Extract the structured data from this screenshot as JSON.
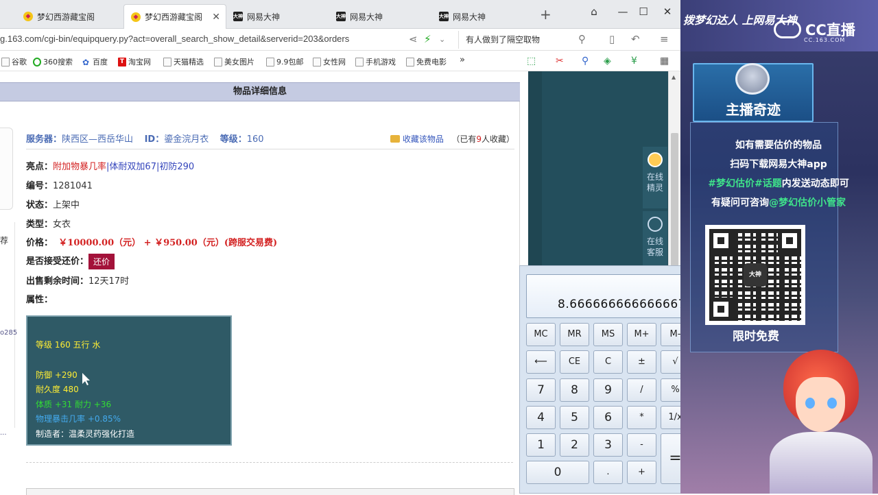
{
  "browser": {
    "tabs": [
      {
        "title": "梦幻西游藏宝阁",
        "icon": "duck-icon",
        "active": false
      },
      {
        "title": "梦幻西游藏宝阁",
        "icon": "duck-icon",
        "active": true
      },
      {
        "title": "网易大神",
        "icon": "dashen-icon",
        "active": false
      },
      {
        "title": "网易大神",
        "icon": "dashen-icon",
        "active": false
      },
      {
        "title": "网易大神",
        "icon": "dashen-icon",
        "active": false
      }
    ],
    "tab_icon_label": "大神",
    "new_tab": "+",
    "url": "g.163.com/cgi-bin/equipquery.py?act=overall_search_show_detail&serverid=203&orders",
    "search_text": "有人做到了隔空取物",
    "bookmarks": [
      "谷歌",
      "360搜索",
      "百度",
      "淘宝网",
      "天猫精选",
      "美女图片",
      "9.9包邮",
      "女性网",
      "手机游戏",
      "免费电影"
    ],
    "bookmark_more": "»",
    "taobao_mark": "T"
  },
  "panel": {
    "title": "物品详细信息",
    "server_label": "服务器：",
    "server_value": "陕西区—西岳华山",
    "id_label": "ID：",
    "id_value": "鎏金浣月衣",
    "level_label": "等级：",
    "level_value": "160",
    "favorite_link": "收藏该物品",
    "favorite_count_pre": "（已有",
    "favorite_count": "9",
    "favorite_count_post": "人收藏）",
    "highlight_label": "亮点：",
    "highlight_1": "附加物暴几率",
    "highlight_sep": "|",
    "highlight_2": "体耐双加67",
    "highlight_3": "初防290",
    "serial_label": "编号：",
    "serial_value": "1281041",
    "status_label": "状态：",
    "status_value": "上架中",
    "type_label": "类型：",
    "type_value": "女衣",
    "price_label": "价格：",
    "price_value": "￥10000.00（元） + ￥950.00（元）(跨服交易费)",
    "counter_label": "是否接受还价：",
    "counter_button": "还价",
    "remain_label": "出售剩余时间：",
    "remain_value": "12天17时",
    "attr_label": "属性："
  },
  "attributes": {
    "level_line": "等级 160  五行 水",
    "defense": "防御 +290",
    "durability": "耐久度 480",
    "bonus": "体质 +31  耐力 +36",
    "crit": "物理暴击几率 +0.85%",
    "maker": "制造者：温柔灵药强化打造"
  },
  "left_strip": {
    "item_a": "荐",
    "item_b": "o285",
    "item_c": "..."
  },
  "side_buttons": {
    "elf_line1": "在线",
    "elf_line2": "精灵",
    "cs_line1": "在线",
    "cs_line2": "客服"
  },
  "calculator": {
    "display": "8.666666666666667",
    "keys": {
      "mc": "MC",
      "mr": "MR",
      "ms": "MS",
      "mplus": "M+",
      "mminus": "M-",
      "back": "⟵",
      "ce": "CE",
      "c": "C",
      "plusminus": "±",
      "sqrt": "√",
      "k7": "7",
      "k8": "8",
      "k9": "9",
      "div": "/",
      "pct": "%",
      "k4": "4",
      "k5": "5",
      "k6": "6",
      "mul": "*",
      "recip": "1/x",
      "k1": "1",
      "k2": "2",
      "k3": "3",
      "sub": "-",
      "eq": "=",
      "k0": "0",
      "dot": ".",
      "add": "+"
    }
  },
  "cc_stream": {
    "slogan": "拨梦幻达人 上网易大神",
    "logo": "CC直播",
    "logo_sub": "CC.163.COM",
    "anchor_name": "主播奇迹",
    "line1": "如有需要估价的物品",
    "line2": "扫码下载网易大神app",
    "line3_tag": "#梦幻估价#话题",
    "line3_rest": "内发送动态即可",
    "line4_pre": "有疑问可咨询",
    "line4_handle": "@梦幻估价小管家",
    "qr_center": "大神",
    "free_label": "限时免费"
  },
  "colors": {
    "panel_header": "#c5cbe2",
    "price_red": "#d32222",
    "counter_btn": "#a3123a",
    "attr_box": "#2f5a66"
  }
}
